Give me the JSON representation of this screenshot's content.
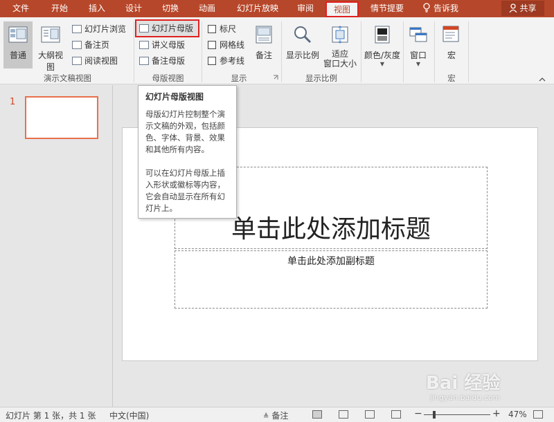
{
  "tabs": [
    "文件",
    "开始",
    "插入",
    "设计",
    "切换",
    "动画",
    "幻灯片放映",
    "审阅",
    "视图",
    "情节提要"
  ],
  "tellme": "告诉我",
  "share": "共享",
  "ribbon": {
    "normal": "普通",
    "outline": "大纲视图",
    "slide_sorter": "幻灯片浏览",
    "notes_page": "备注页",
    "reading_view": "阅读视图",
    "group_presentation_views": "演示文稿视图",
    "slide_master": "幻灯片母版",
    "handout_master": "讲义母版",
    "notes_master": "备注母版",
    "group_master_views": "母版视图",
    "ruler": "标尺",
    "gridlines": "网格线",
    "guides": "参考线",
    "notes": "备注",
    "group_show": "显示",
    "zoom": "显示比例",
    "fit_window_1": "适应",
    "fit_window_2": "窗口大小",
    "group_zoom": "显示比例",
    "color_grayscale": "颜色/灰度",
    "window": "窗口",
    "macros": "宏",
    "group_macros": "宏"
  },
  "tooltip": {
    "title": "幻灯片母版视图",
    "p1": "母版幻灯片控制整个演示文稿的外观，包括颜色、字体、背景、效果和其他所有内容。",
    "p2": "可以在幻灯片母版上插入形状或徽标等内容，它会自动显示在所有幻灯片上。"
  },
  "slide_number": "1",
  "slide": {
    "title_placeholder": "单击此处添加标题",
    "subtitle_placeholder": "单击此处添加副标题"
  },
  "status": {
    "slide_info": "幻灯片 第 1 张，共 1 张",
    "language": "中文(中国)",
    "notes": "备注",
    "zoom_level": "47%"
  },
  "watermark": {
    "main": "Bai 经验",
    "sub": "jingyan.baidu.com"
  }
}
